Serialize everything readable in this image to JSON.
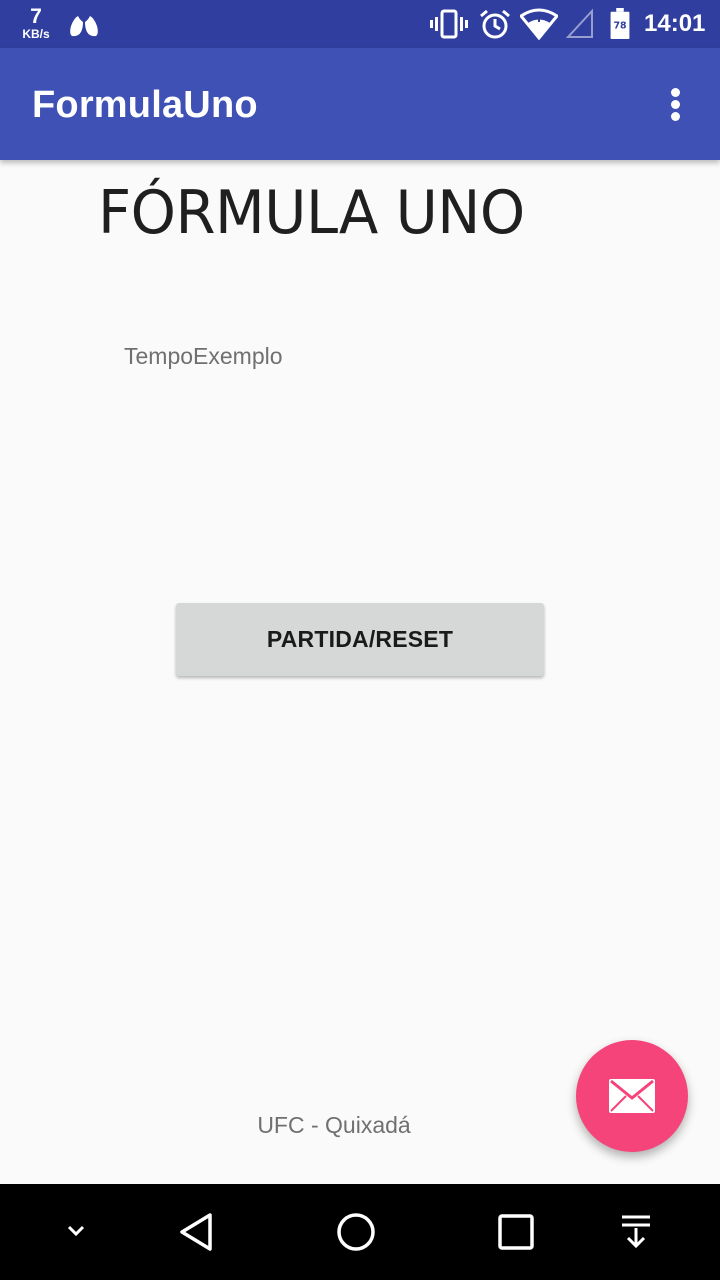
{
  "status_bar": {
    "net_speed_value": "7",
    "net_speed_unit": "KB/s",
    "time": "14:01",
    "battery_level": "78",
    "icons": [
      "lungs-icon",
      "vibrate-icon",
      "alarm-icon",
      "wifi-icon",
      "signal-icon",
      "battery-icon"
    ]
  },
  "app_bar": {
    "title": "FormulaUno",
    "overflow_icon": "more-vert-icon"
  },
  "content": {
    "heading": "FÓRMULA UNO",
    "time_label": "TempoExemplo",
    "button_label": "PARTIDA/RESET",
    "footer": "UFC - Quixadá"
  },
  "fab": {
    "icon": "email-icon",
    "color": "#f5447a"
  },
  "nav_bar": {
    "icons": [
      "chevron-down-icon",
      "back-icon",
      "home-icon",
      "recents-icon",
      "notification-pull-icon"
    ]
  },
  "colors": {
    "primary": "#3f51b5",
    "primary_dark": "#303f9f",
    "accent": "#f5447a",
    "background": "#fafafa"
  }
}
